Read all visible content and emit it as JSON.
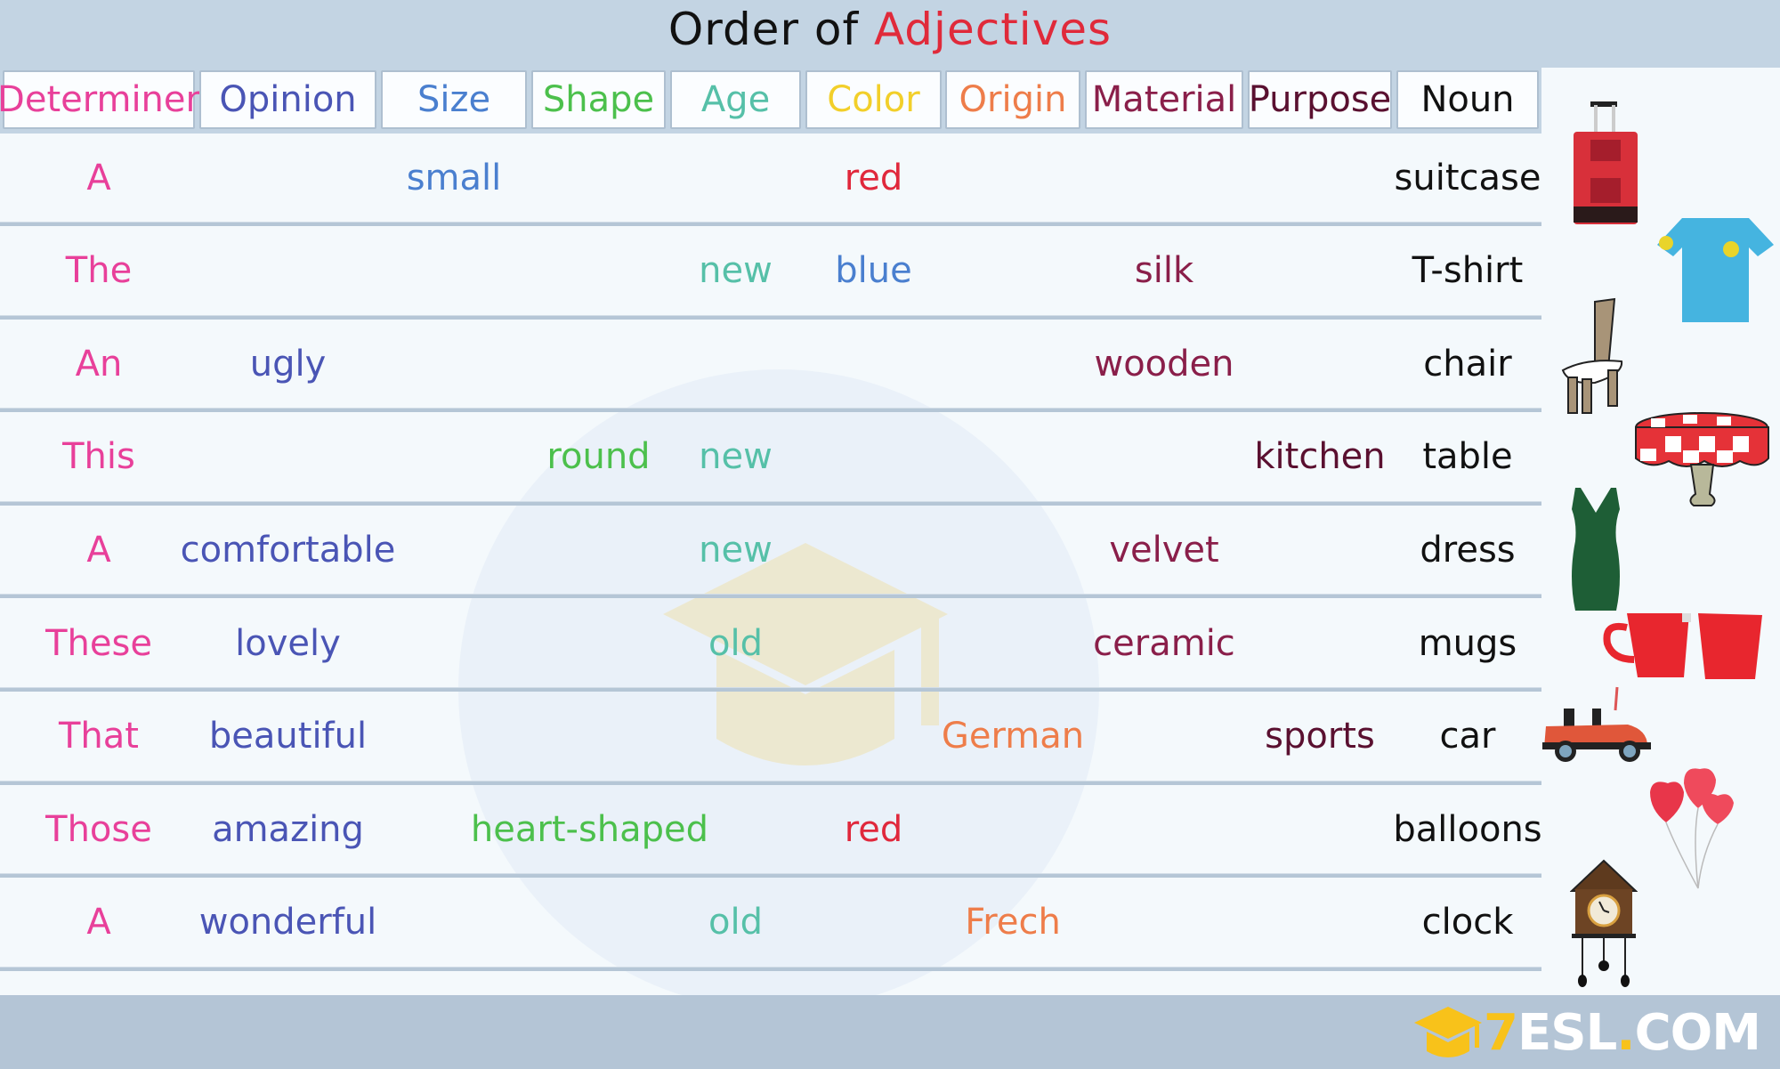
{
  "title": {
    "part1": "Order of ",
    "part2": "Adjectives"
  },
  "colors": {
    "determiner": "#e8409a",
    "opinion": "#4a55b5",
    "size": "#4a7fcf",
    "shape": "#4cc04c",
    "age": "#56c0a8",
    "color": "#f2cf2a",
    "origin": "#ee7d4a",
    "material": "#8a1f4a",
    "purpose": "#5a1030",
    "noun": "#111111"
  },
  "columns": [
    {
      "key": "determiner",
      "label": "Determiner"
    },
    {
      "key": "opinion",
      "label": "Opinion"
    },
    {
      "key": "size",
      "label": "Size"
    },
    {
      "key": "shape",
      "label": "Shape"
    },
    {
      "key": "age",
      "label": "Age"
    },
    {
      "key": "color",
      "label": "Color"
    },
    {
      "key": "origin",
      "label": "Origin"
    },
    {
      "key": "material",
      "label": "Material"
    },
    {
      "key": "purpose",
      "label": "Purpose"
    },
    {
      "key": "noun",
      "label": "Noun"
    }
  ],
  "rows": [
    {
      "determiner": "A",
      "opinion": "",
      "size": "small",
      "shape": "",
      "age": "",
      "color": "red",
      "origin": "",
      "material": "",
      "purpose": "",
      "noun": "suitcase",
      "color_word_hex": "#e0283c",
      "picture": "suitcase-icon"
    },
    {
      "determiner": "The",
      "opinion": "",
      "size": "",
      "shape": "",
      "age": "new",
      "color": "blue",
      "origin": "",
      "material": "silk",
      "purpose": "",
      "noun": "T-shirt",
      "color_word_hex": "#4a7fcf",
      "picture": "t-shirt-icon"
    },
    {
      "determiner": "An",
      "opinion": "ugly",
      "size": "",
      "shape": "",
      "age": "",
      "color": "",
      "origin": "",
      "material": "wooden",
      "purpose": "",
      "noun": "chair",
      "color_word_hex": "",
      "picture": "chair-icon"
    },
    {
      "determiner": "This",
      "opinion": "",
      "size": "",
      "shape": "round",
      "age": "new",
      "color": "",
      "origin": "",
      "material": "",
      "purpose": "kitchen",
      "noun": "table",
      "color_word_hex": "",
      "picture": "table-icon"
    },
    {
      "determiner": "A",
      "opinion": "comfortable",
      "size": "",
      "shape": "",
      "age": "new",
      "color": "",
      "origin": "",
      "material": "velvet",
      "purpose": "",
      "noun": "dress",
      "color_word_hex": "",
      "picture": "dress-icon"
    },
    {
      "determiner": "These",
      "opinion": "lovely",
      "size": "",
      "shape": "",
      "age": "old",
      "color": "",
      "origin": "",
      "material": "ceramic",
      "purpose": "",
      "noun": "mugs",
      "color_word_hex": "",
      "picture": "mugs-icon"
    },
    {
      "determiner": "That",
      "opinion": "beautiful",
      "size": "",
      "shape": "",
      "age": "",
      "color": "",
      "origin": "German",
      "material": "",
      "purpose": "sports",
      "noun": "car",
      "color_word_hex": "",
      "picture": "car-icon"
    },
    {
      "determiner": "Those",
      "opinion": "amazing",
      "size": "",
      "shape": "heart-shaped",
      "age": "",
      "color": "red",
      "origin": "",
      "material": "",
      "purpose": "",
      "noun": "balloons",
      "color_word_hex": "#e0283c",
      "picture": "balloons-icon"
    },
    {
      "determiner": "A",
      "opinion": "wonderful",
      "size": "",
      "shape": "",
      "age": "old",
      "color": "",
      "origin": "Frech",
      "material": "",
      "purpose": "",
      "noun": "clock",
      "color_word_hex": "",
      "picture": "clock-icon"
    }
  ],
  "footer": {
    "logo_seven": "7",
    "logo_esl": "ESL",
    "logo_dot": ".",
    "logo_com": "COM"
  }
}
